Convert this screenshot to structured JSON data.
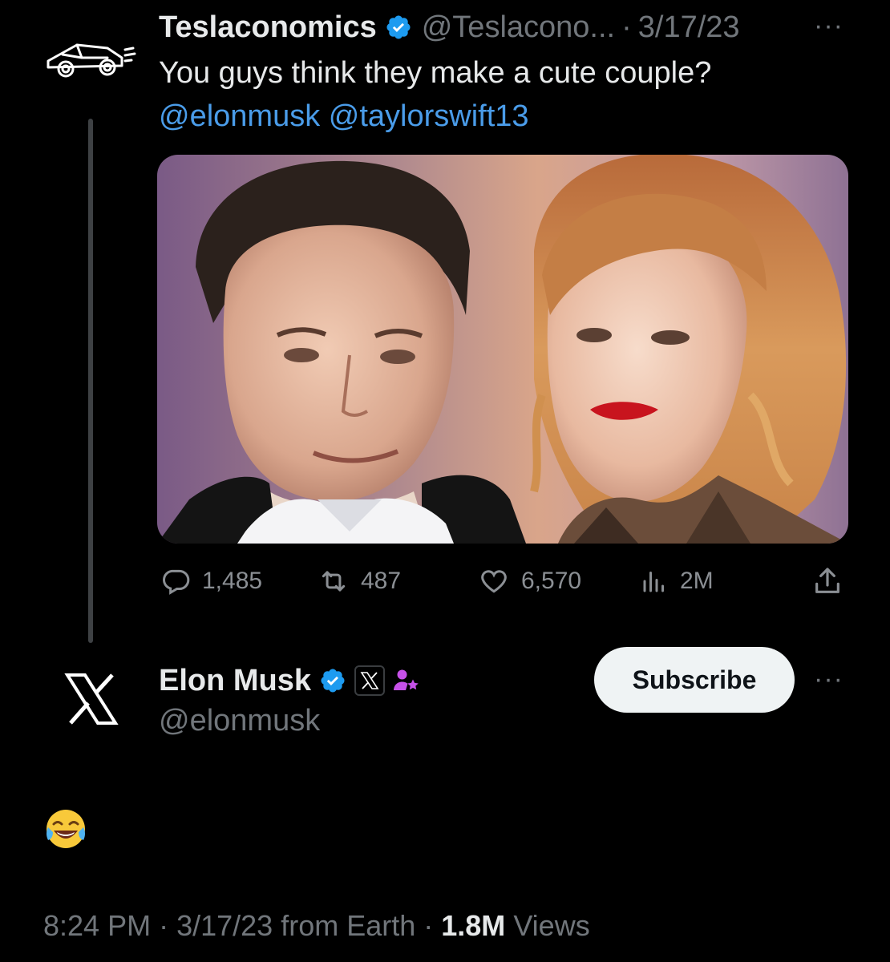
{
  "quoted_tweet": {
    "author_name": "Teslaconomics",
    "author_handle": "@Teslacono...",
    "separator": "·",
    "date": "3/17/23",
    "more": "···",
    "text": "You guys think they make a cute couple?",
    "mentions": [
      "@elonmusk",
      "@taylorswift13"
    ],
    "stats": {
      "replies": "1,485",
      "reposts": "487",
      "likes": "6,570",
      "views": "2M"
    }
  },
  "reply_tweet": {
    "author_name": "Elon Musk",
    "author_handle": "@elonmusk",
    "subscribe_label": "Subscribe",
    "more": "···",
    "text": "😂",
    "time": "8:24 PM",
    "sep1": " · ",
    "date": "3/17/23",
    "source": " from Earth",
    "sep2": " · ",
    "views_count": "1.8M",
    "views_label": " Views"
  },
  "colors": {
    "background": "#000000",
    "text_primary": "#e7e9ea",
    "text_muted": "#71767b",
    "link": "#4a9ce9",
    "verified": "#1d9bf0",
    "subscriber_badge": "#c651e8"
  },
  "icons": [
    "tesla-car-icon",
    "verified-badge-icon",
    "reply-icon",
    "repost-icon",
    "like-icon",
    "views-icon",
    "share-icon",
    "x-logo-icon",
    "affiliate-x-icon",
    "subscriber-badge-icon",
    "more-icon"
  ]
}
